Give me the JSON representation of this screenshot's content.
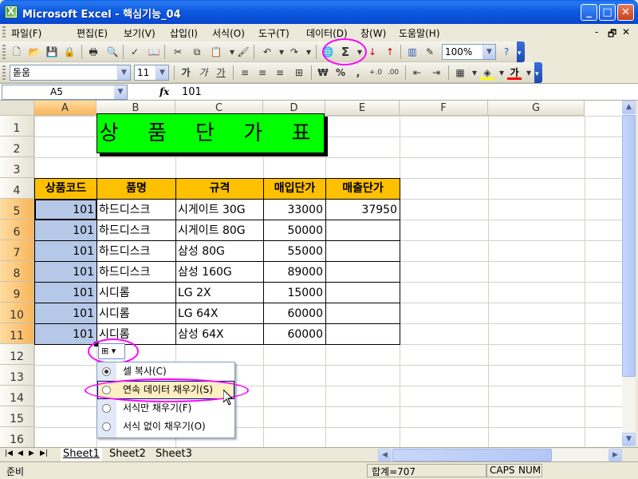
{
  "window": {
    "title": "Microsoft Excel - 핵심기능_04",
    "icon_letter": "X"
  },
  "window_buttons": {
    "minimize": "_",
    "maximize": "□",
    "close": "✕"
  },
  "menu": {
    "items": [
      "파일(F)",
      "편집(E)",
      "보기(V)",
      "삽입(I)",
      "서식(O)",
      "도구(T)",
      "데이터(D)",
      "창(W)",
      "도움말(H)"
    ],
    "right_min": "-",
    "right_restore": "🗗",
    "right_close": "✕"
  },
  "toolbar_standard": {
    "zoom": "100%",
    "autosum": "Σ"
  },
  "toolbar_format": {
    "font": "돋움",
    "size": "11",
    "bold": "가",
    "italic": "가",
    "underline": "가",
    "currency": "₩",
    "percent": "%",
    "comma": ","
  },
  "formula_bar": {
    "name_box": "A5",
    "fx": "fx",
    "value": "101"
  },
  "columns": [
    "A",
    "B",
    "C",
    "D",
    "E",
    "F",
    "G"
  ],
  "rows": [
    "1",
    "2",
    "3",
    "4",
    "5",
    "6",
    "7",
    "8",
    "9",
    "10",
    "11",
    "12",
    "13",
    "14",
    "15",
    "16"
  ],
  "sheet": {
    "title": "상 품 단 가 표",
    "headers": [
      "상품코드",
      "품명",
      "규격",
      "매입단가",
      "매출단가"
    ],
    "data": [
      [
        "101",
        "하드디스크",
        "시게이트 30G",
        "33000",
        "37950"
      ],
      [
        "101",
        "하드디스크",
        "시게이트 80G",
        "50000",
        ""
      ],
      [
        "101",
        "하드디스크",
        "삼성 80G",
        "55000",
        ""
      ],
      [
        "101",
        "하드디스크",
        "삼성 160G",
        "89000",
        ""
      ],
      [
        "101",
        "시디롬",
        "LG 2X",
        "15000",
        ""
      ],
      [
        "101",
        "시디롬",
        "LG 64X",
        "60000",
        ""
      ],
      [
        "101",
        "시디롬",
        "삼성 64X",
        "60000",
        ""
      ]
    ]
  },
  "autofill_menu": {
    "items": [
      "셀 복사(C)",
      "연속 데이터 채우기(S)",
      "서식만 채우기(F)",
      "서식 없이 채우기(O)"
    ]
  },
  "tabs": [
    "Sheet1",
    "Sheet2",
    "Sheet3"
  ],
  "status": {
    "ready": "준비",
    "sum": "합계=707",
    "caps": "CAPS",
    "num": "NUM"
  },
  "colors": {
    "title_bg": "#00ff00",
    "header_bg": "#ffc000",
    "highlight": "#ff00ff",
    "selection": "#b6c8e8"
  }
}
